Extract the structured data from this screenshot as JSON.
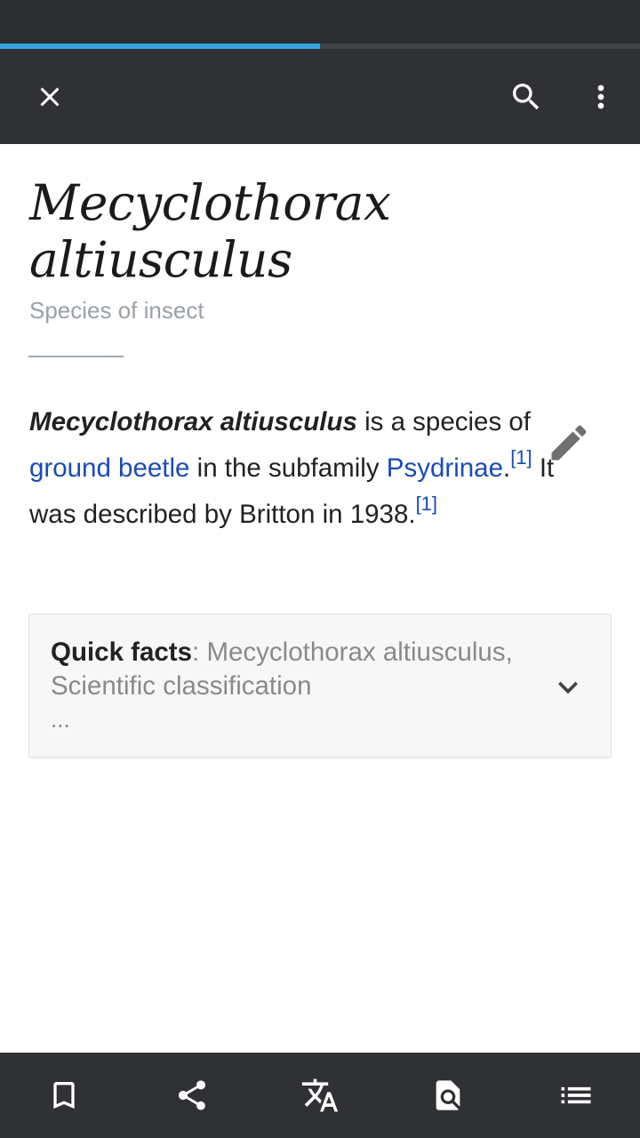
{
  "page_load_progress": 0.5,
  "colors": {
    "accent": "#36a3dc",
    "toolbar": "#2f3134",
    "link": "#1a4bb5",
    "description": "#9aa0a6"
  },
  "toolbar": {
    "close_icon": "close-icon",
    "search_icon": "search-icon",
    "more_icon": "more-vertical-icon"
  },
  "article": {
    "title": "Mecyclothorax altiusculus",
    "description": "Species of insect",
    "intro": {
      "bold_name": "Mecyclothorax altiusculus",
      "text_1": " is a species of ",
      "link_1": "ground beetle",
      "text_2": " in the subfamily ",
      "link_2": "Psydrinae",
      "text_3": ".",
      "ref_1": "[1]",
      "text_4": " It was described by Britton in 1938.",
      "ref_2": "[1]"
    },
    "edit_icon": "pencil-icon"
  },
  "quick_facts": {
    "label": "Quick facts",
    "separator": ": ",
    "summary": "Mecyclothorax altiusculus, Scientific classification",
    "ellipsis": "...",
    "expand_icon": "chevron-down-icon"
  },
  "bottom_bar": {
    "icons": [
      "bookmark-icon",
      "share-icon",
      "translate-icon",
      "find-in-page-icon",
      "table-of-contents-icon"
    ]
  }
}
